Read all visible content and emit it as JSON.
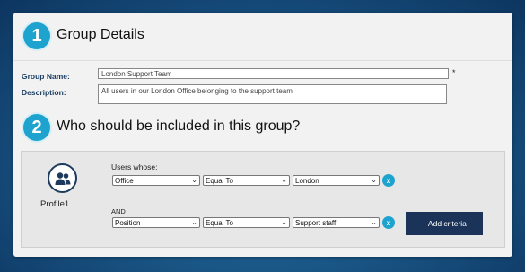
{
  "section1": {
    "step_number": "1",
    "title": "Group Details"
  },
  "form": {
    "group_name_label": "Group Name:",
    "group_name_value": "London Support Team",
    "required_marker": "*",
    "description_label": "Description:",
    "description_value": "All users in our London Office belonging to the support team"
  },
  "section2": {
    "step_number": "2",
    "title": "Who should be included in this group?"
  },
  "criteria": {
    "profile_label": "Profile1",
    "users_whose_label": "Users whose:",
    "and_label": "AND",
    "rows": [
      {
        "field": "Office",
        "operator": "Equal To",
        "value": "London"
      },
      {
        "field": "Position",
        "operator": "Equal To",
        "value": "Support staff"
      }
    ],
    "remove_label": "x",
    "add_criteria_label": "+ Add criteria"
  },
  "colors": {
    "accent": "#1ea3cf",
    "navy": "#1b3358"
  },
  "icons": {
    "profile": "users-group-icon",
    "dropdown": "chevron-down-icon"
  }
}
